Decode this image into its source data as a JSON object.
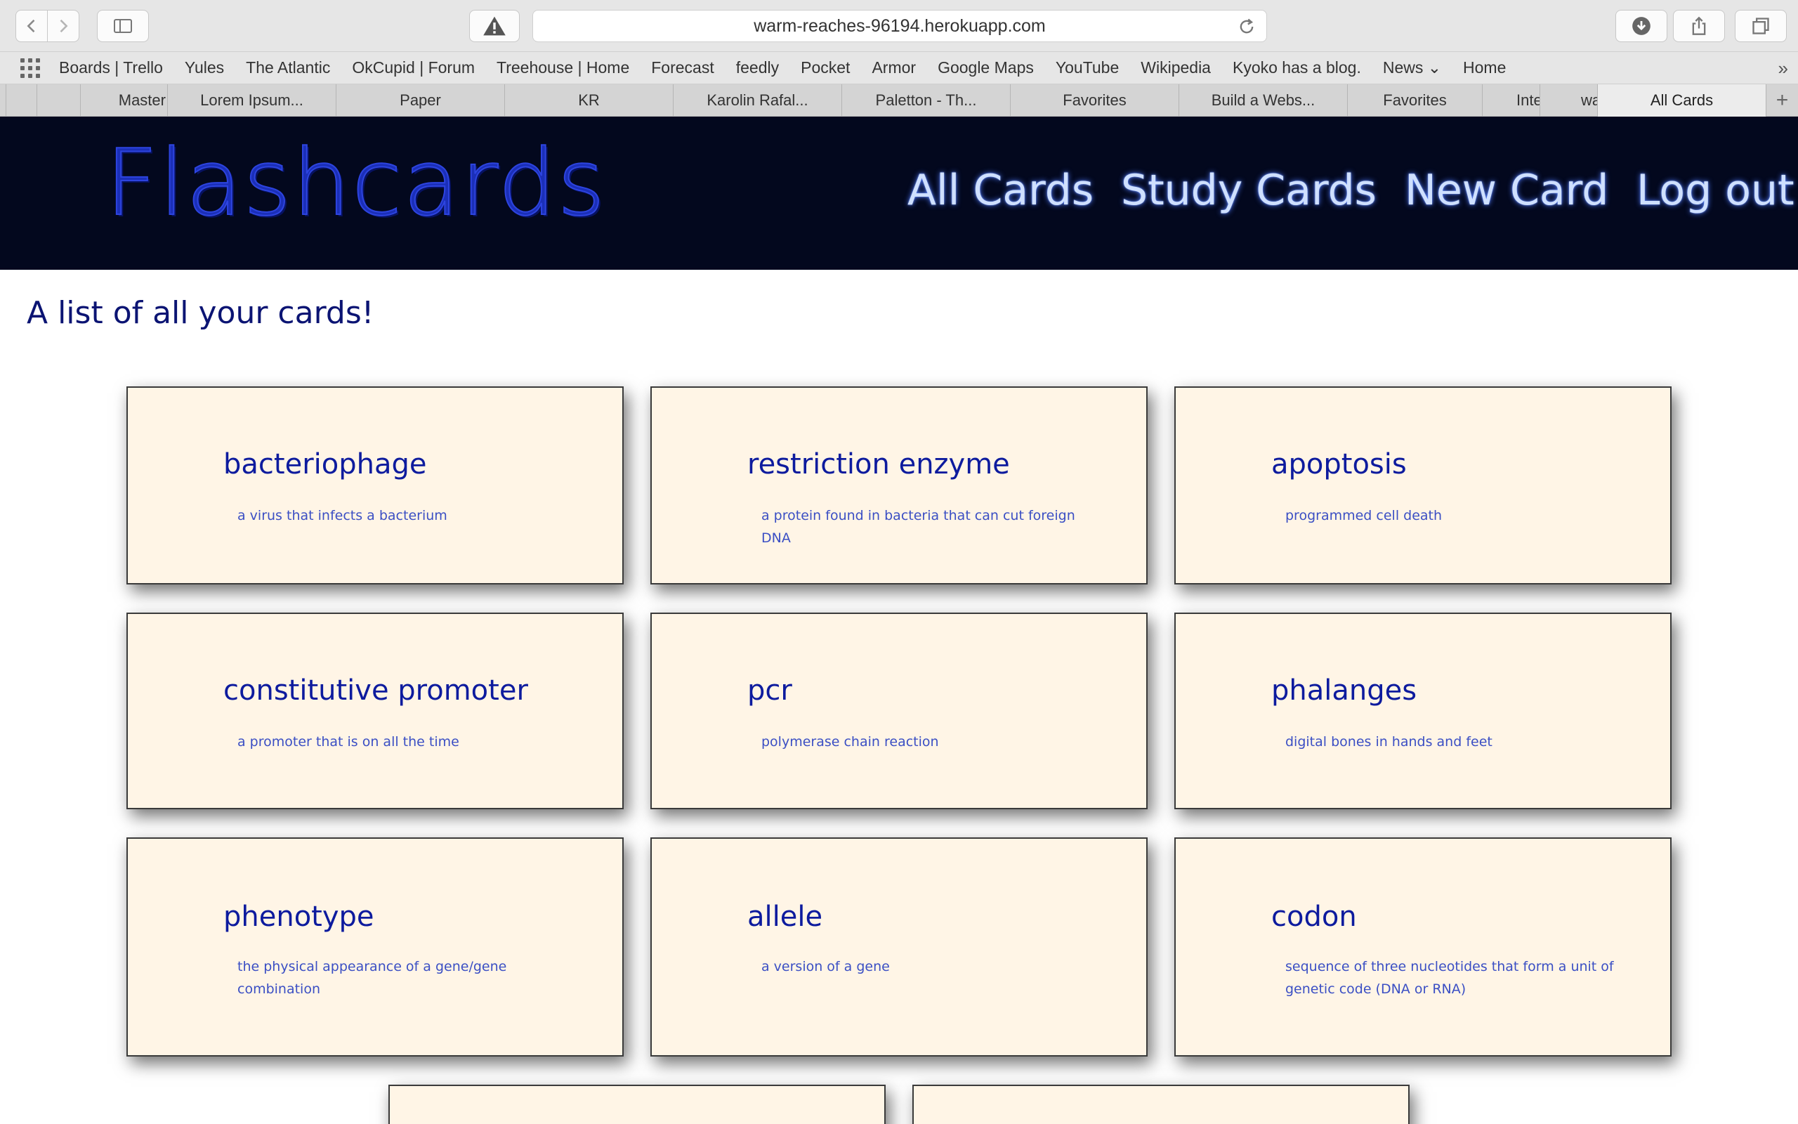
{
  "browser": {
    "url": "warm-reaches-96194.herokuapp.com",
    "bookmarks": [
      "Boards | Trello",
      "Yules",
      "The Atlantic",
      "OkCupid | Forum",
      "Treehouse | Home",
      "Forecast",
      "feedly",
      "Pocket",
      "Armor",
      "Google Maps",
      "YouTube",
      "Wikipedia",
      "Kyoko has a blog.",
      "News ⌄",
      "Home"
    ],
    "tabs": [
      "Master",
      "Lorem Ipsum...",
      "Paper",
      "KR",
      "Karolin Rafal...",
      "Paletton - Th...",
      "Favorites",
      "Build a Webs...",
      "Favorites",
      "Inte",
      "wa",
      "All Cards"
    ]
  },
  "site": {
    "logo": "Flashcards",
    "nav": [
      "All Cards",
      "Study Cards",
      "New Card",
      "Log out"
    ],
    "page_title": "A list of all your cards!"
  },
  "cards": [
    {
      "term": "bacteriophage",
      "definition": "a virus that infects a bacterium"
    },
    {
      "term": "restriction enzyme",
      "definition": "a protein found in bacteria that can cut foreign DNA"
    },
    {
      "term": "apoptosis",
      "definition": "programmed cell death"
    },
    {
      "term": "constitutive promoter",
      "definition": "a promoter that is on all the time"
    },
    {
      "term": "pcr",
      "definition": "polymerase chain reaction"
    },
    {
      "term": "phalanges",
      "definition": "digital bones in hands and feet"
    },
    {
      "term": "phenotype",
      "definition": "the physical appearance of a gene/gene combination"
    },
    {
      "term": "allele",
      "definition": "a version of a gene"
    },
    {
      "term": "codon",
      "definition": "sequence of three nucleotides that form a unit of genetic code (DNA or RNA)"
    },
    {
      "term": "",
      "definition": ""
    },
    {
      "term": "",
      "definition": ""
    }
  ]
}
